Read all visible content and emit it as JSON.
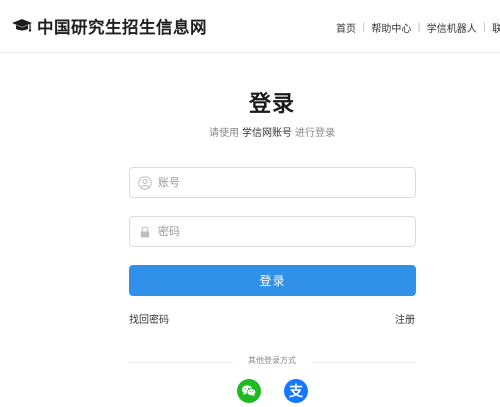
{
  "header": {
    "site_title": "中国研究生招生信息网",
    "nav": [
      {
        "label": "首页"
      },
      {
        "label": "帮助中心"
      },
      {
        "label": "学信机器人"
      },
      {
        "label": "联"
      }
    ]
  },
  "login": {
    "title": "登录",
    "subtitle_prefix": "请使用",
    "subtitle_brand": "学信网账号",
    "subtitle_suffix": "进行登录",
    "account_placeholder": "账号",
    "password_placeholder": "密码",
    "submit_label": "登录",
    "forgot_password": "找回密码",
    "register": "注册",
    "other_methods": "其他登录方式"
  },
  "colors": {
    "primary": "#3190e8",
    "wechat": "#1fb922",
    "alipay": "#1677ff"
  },
  "icons": [
    "mortarboard-icon",
    "user-icon",
    "lock-icon",
    "wechat-icon",
    "alipay-icon"
  ]
}
